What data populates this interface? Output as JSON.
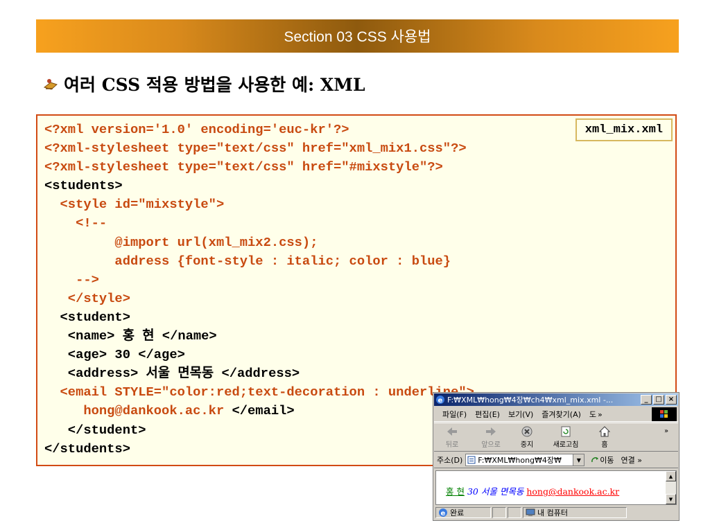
{
  "section": {
    "title": "Section 03 CSS 사용법"
  },
  "heading": {
    "text": "여러 CSS 적용 방법을 사용한 예: XML",
    "icon": "bullet-icon"
  },
  "file_label": "xml_mix.xml",
  "code": {
    "lines": [
      [
        {
          "t": "<?xml version='1.0' encoding='euc-kr'?>",
          "c": "orange"
        }
      ],
      [
        {
          "t": "<?xml-stylesheet type=\"text/css\" href=\"xml_mix1.css\"?>",
          "c": "orange"
        }
      ],
      [
        {
          "t": "<?xml-stylesheet type=\"text/css\" href=\"#mixstyle\"?>",
          "c": "orange"
        }
      ],
      [
        {
          "t": "<students>",
          "c": "black"
        }
      ],
      [
        {
          "t": "  <style id=\"mixstyle\">",
          "c": "orange"
        }
      ],
      [
        {
          "t": "    <!--",
          "c": "orange"
        }
      ],
      [
        {
          "t": "         @import url(xml_mix2.css);",
          "c": "orange"
        }
      ],
      [
        {
          "t": "         address {font-style : italic; color : blue}",
          "c": "orange"
        }
      ],
      [
        {
          "t": "    -->",
          "c": "orange"
        }
      ],
      [
        {
          "t": "   </style>",
          "c": "orange"
        }
      ],
      [
        {
          "t": "  <student>",
          "c": "black"
        }
      ],
      [
        {
          "t": "   <name> 홍 현 </name>",
          "c": "black"
        }
      ],
      [
        {
          "t": "   <age> 30 </age>",
          "c": "black"
        }
      ],
      [
        {
          "t": "   <address> 서울 면목동 </address>",
          "c": "black"
        }
      ],
      [
        {
          "t": "  <email STYLE=\"color:red;text-decoration : underline\">",
          "c": "orange"
        }
      ],
      [
        {
          "t": "     hong@dankook.ac.kr ",
          "c": "orange"
        },
        {
          "t": "</email>",
          "c": "black"
        }
      ],
      [
        {
          "t": "   </student>",
          "c": "black"
        }
      ],
      [
        {
          "t": "</students>",
          "c": "black"
        }
      ]
    ]
  },
  "browser": {
    "title": "F:₩XML₩hong₩4장₩ch4₩xml_mix.xml -...",
    "window_buttons": {
      "minimize": "_",
      "maximize": "□",
      "close": "×"
    },
    "menu": [
      "파일(F)",
      "편집(E)",
      "보기(V)",
      "즐겨찾기(A)",
      "도"
    ],
    "menu_more": "»",
    "toolbar": {
      "back": "뒤로",
      "forward": "앞으로",
      "stop": "중지",
      "refresh": "새로고침",
      "home": "홈",
      "more": "»"
    },
    "address_label": "주소(D)",
    "address_value": "F:₩XML₩hong₩4장₩",
    "go_label": "이동",
    "links_label": "연결 »",
    "content": {
      "name": "홍 현",
      "age": "30",
      "address": "서울 면목동",
      "email": "hong@dankook.ac.kr"
    },
    "status": {
      "left": "완료",
      "zone": "내 컴퓨터"
    }
  },
  "colors": {
    "accent_orange": "#c84a10",
    "box_border": "#d24a14",
    "box_bg": "#ffffea",
    "bar_gradient_edge": "#f7a11e",
    "bar_gradient_center": "#8e5a0e"
  }
}
